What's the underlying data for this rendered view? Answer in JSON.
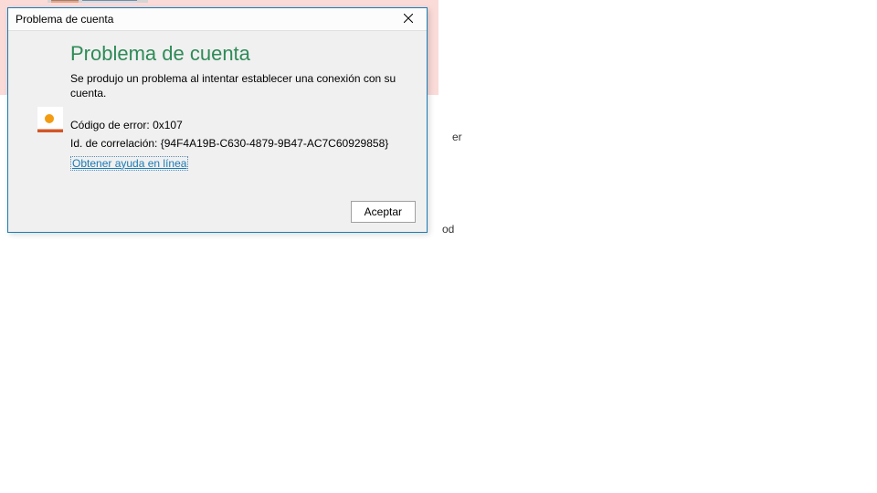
{
  "dialog": {
    "title": "Problema de cuenta",
    "heading": "Problema de cuenta",
    "message": "Se produjo un problema al intentar establecer una conexión con su cuenta.",
    "error_code_label": "Código de error:",
    "error_code_value": "0x107",
    "correlation_label": "Id. de correlación:",
    "correlation_value": "{94F4A19B-C630-4879-9B47-AC7C60929858}",
    "help_link": "Obtener ayuda en línea",
    "accept_button": "Aceptar"
  },
  "background": {
    "snippet1": "er",
    "snippet2": "od"
  }
}
